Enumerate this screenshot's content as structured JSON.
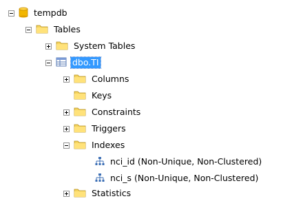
{
  "tree": {
    "database": {
      "label": "tempdb",
      "icon": "database-icon",
      "expanded": true
    },
    "tables": {
      "label": "Tables",
      "icon": "folder-icon",
      "expanded": true
    },
    "system_tables": {
      "label": "System Tables",
      "icon": "folder-icon",
      "expanded": false
    },
    "table": {
      "label": "dbo.TI",
      "icon": "table-icon",
      "expanded": true,
      "selected": true
    },
    "columns": {
      "label": "Columns",
      "icon": "folder-icon",
      "expanded": false
    },
    "keys": {
      "label": "Keys",
      "icon": "folder-icon"
    },
    "constraints": {
      "label": "Constraints",
      "icon": "folder-icon",
      "expanded": false
    },
    "triggers": {
      "label": "Triggers",
      "icon": "folder-icon",
      "expanded": false
    },
    "indexes": {
      "label": "Indexes",
      "icon": "folder-icon",
      "expanded": true
    },
    "index_items": [
      {
        "label": "nci_id (Non-Unique, Non-Clustered)",
        "icon": "index-icon"
      },
      {
        "label": "nci_s (Non-Unique, Non-Clustered)",
        "icon": "index-icon"
      }
    ],
    "statistics": {
      "label": "Statistics",
      "icon": "folder-icon",
      "expanded": false
    }
  },
  "colors": {
    "selection": "#3399ff",
    "folder": "#f5d45f",
    "database": "#f2b600"
  }
}
